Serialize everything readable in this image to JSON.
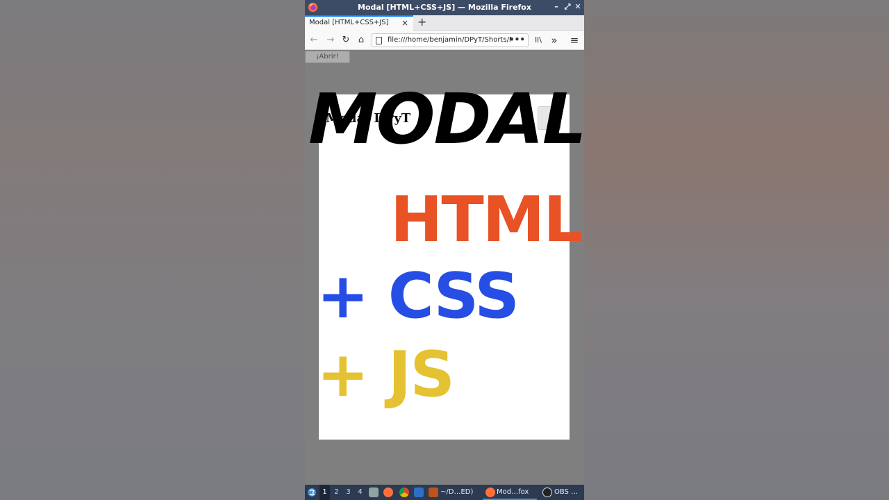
{
  "window": {
    "title": "Modal [HTML+CSS+JS] — Mozilla Firefox",
    "controls": {
      "minimize": "–",
      "maximize": "⤢",
      "close": "✕"
    }
  },
  "tabs": [
    {
      "label": "Modal [HTML+CSS+JS]",
      "close": "×"
    }
  ],
  "newtab": "+",
  "nav": {
    "back": "←",
    "forward": "→",
    "reload": "↻",
    "home": "⌂",
    "url": "file:///home/benjamin/DPyT/Shorts/M",
    "more": "•••",
    "library": "ll\\",
    "overflow": "»",
    "menu": "≡"
  },
  "page": {
    "open_button": "¡Abrir!",
    "modal_title": "Modal DPyT"
  },
  "overlay": {
    "modal": "MODAL",
    "html": "HTML",
    "css": "+ CSS",
    "js": "+ JS"
  },
  "colors": {
    "html": "#e85224",
    "css": "#264de4",
    "js": "#e4c232",
    "titlebar": "#3c4c66",
    "tab_accent": "#0a84ff"
  },
  "taskbar": {
    "workspaces": [
      "1",
      "2",
      "3",
      "4"
    ],
    "active_workspace": "1",
    "tasks": [
      {
        "label": "~/D…ED)",
        "icon": "terminal-icon"
      },
      {
        "label": "Mod…fox",
        "icon": "firefox-icon",
        "active": true
      },
      {
        "label": "OBS …tu",
        "icon": "obs-icon"
      }
    ]
  }
}
